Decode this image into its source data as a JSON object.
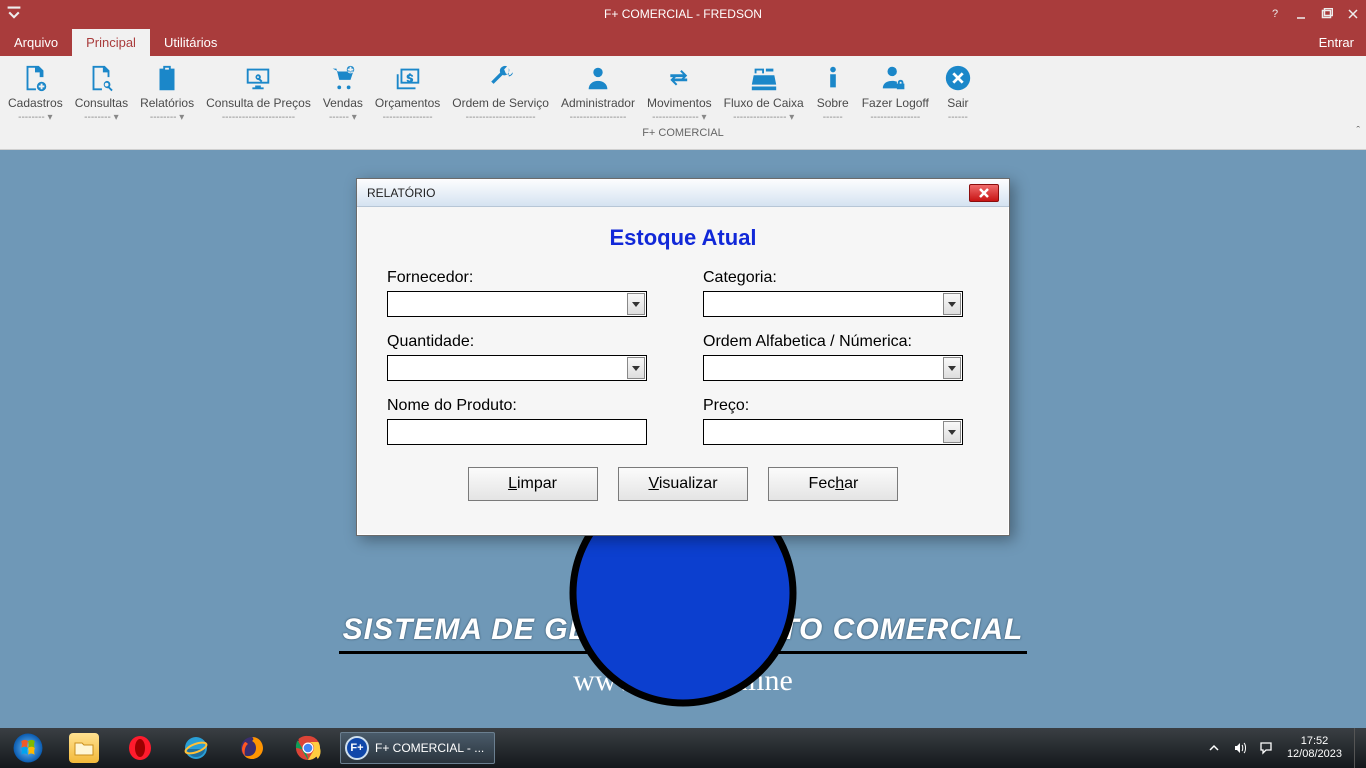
{
  "titlebar": {
    "title": "F+ COMERCIAL - FREDSON"
  },
  "menutabs": {
    "arquivo": "Arquivo",
    "principal": "Principal",
    "utilitarios": "Utilitários",
    "entrar": "Entrar"
  },
  "ribbon": {
    "items": [
      {
        "label": "Cadastros",
        "dropdown": true
      },
      {
        "label": "Consultas",
        "dropdown": true
      },
      {
        "label": "Relatórios",
        "dropdown": true
      },
      {
        "label": "Consulta de Preços",
        "dropdown": false
      },
      {
        "label": "Vendas",
        "dropdown": true
      },
      {
        "label": "Orçamentos",
        "dropdown": false
      },
      {
        "label": "Ordem de Serviço",
        "dropdown": false
      },
      {
        "label": "Administrador",
        "dropdown": false
      },
      {
        "label": "Movimentos",
        "dropdown": true
      },
      {
        "label": "Fluxo de Caixa",
        "dropdown": true
      },
      {
        "label": "Sobre",
        "dropdown": false
      },
      {
        "label": "Fazer Logoff",
        "dropdown": false
      },
      {
        "label": "Sair",
        "dropdown": false
      }
    ],
    "group_label": "F+ COMERCIAL"
  },
  "dialog": {
    "window_title": "RELATÓRIO",
    "heading": "Estoque Atual",
    "fields": {
      "fornecedor": {
        "label": "Fornecedor:",
        "value": ""
      },
      "categoria": {
        "label": "Categoria:",
        "value": ""
      },
      "quantidade": {
        "label": "Quantidade:",
        "value": ""
      },
      "ordem": {
        "label": "Ordem Alfabetica / Númerica:",
        "value": ""
      },
      "nome_produto": {
        "label": "Nome do Produto:",
        "value": ""
      },
      "preco": {
        "label": "Preço:",
        "value": ""
      }
    },
    "buttons": {
      "limpar": "Limpar",
      "visualizar": "Visualizar",
      "fechar": "Fechar"
    }
  },
  "brand": {
    "tagline": "SISTEMA DE GERENCIAMENTO COMERCIAL",
    "url": "www.fmais.online"
  },
  "taskbar": {
    "running_label": "F+ COMERCIAL - ...",
    "clock_time": "17:52",
    "clock_date": "12/08/2023"
  }
}
